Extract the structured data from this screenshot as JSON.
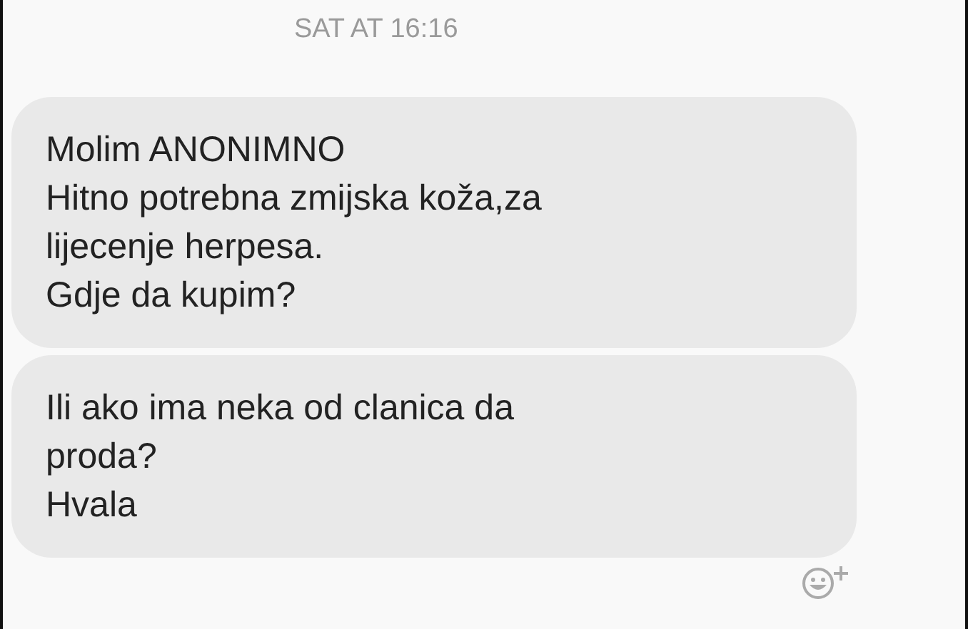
{
  "timestamp": "SAT AT 16:16",
  "messages": [
    {
      "text": "Molim ANONIMNO\nHitno potrebna zmijska koža,za\nlijecenje herpesa.\nGdje da kupim?"
    },
    {
      "text": "Ili ako ima neka od clanica da\nproda?\nHvala"
    }
  ]
}
